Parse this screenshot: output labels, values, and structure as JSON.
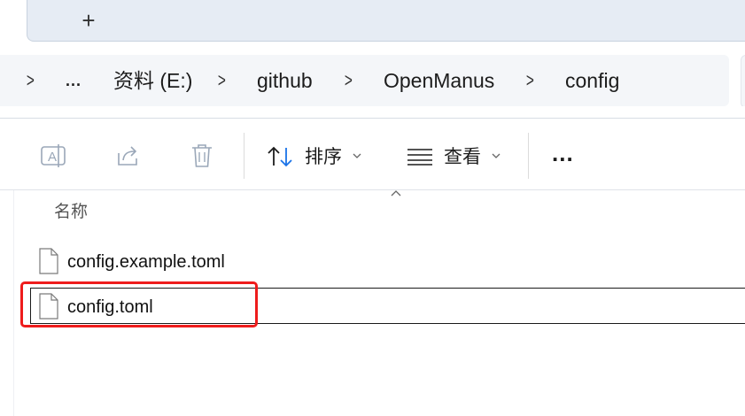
{
  "tabstrip": {
    "new_tab_label": "+"
  },
  "address": {
    "overflow": "...",
    "crumbs": [
      "资料 (E:)",
      "github",
      "OpenManus",
      "config"
    ]
  },
  "commandbar": {
    "sort_label": "排序",
    "view_label": "查看",
    "more_label": "..."
  },
  "list": {
    "column_name": "名称",
    "files": [
      "config.example.toml",
      "config.toml"
    ],
    "selected_index": 1
  },
  "colors": {
    "highlight": "#ee1c1c",
    "accent": "#1a73e8"
  }
}
